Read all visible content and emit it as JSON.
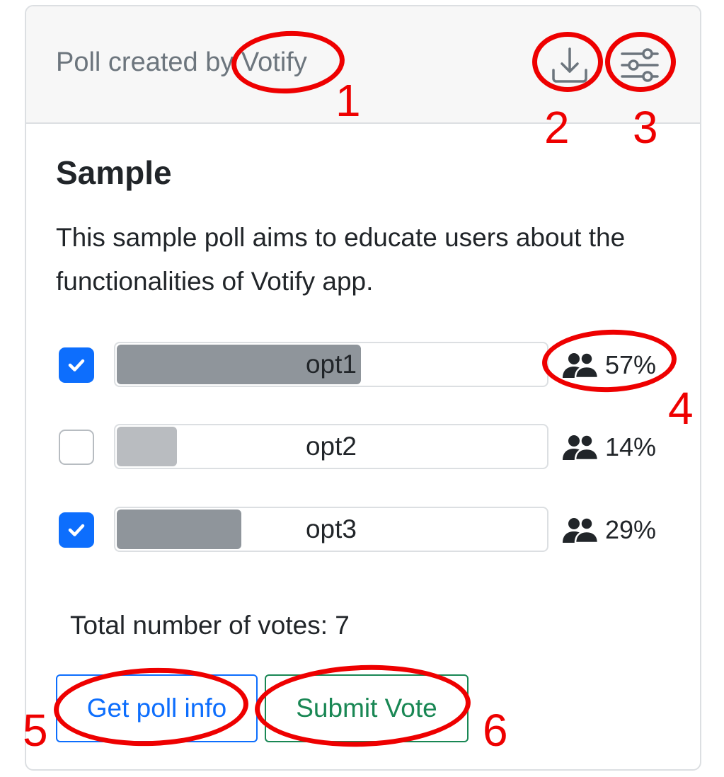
{
  "header": {
    "created_by": "Poll created by Votify",
    "download_icon": "download-icon",
    "settings_icon": "sliders-icon"
  },
  "poll": {
    "title": "Sample",
    "description": "This sample poll aims to educate users about the functionalities of Votify app.",
    "options": [
      {
        "label": "opt1",
        "checked": true,
        "share": 0.57,
        "percent": "57%"
      },
      {
        "label": "opt2",
        "checked": false,
        "share": 0.14,
        "percent": "14%"
      },
      {
        "label": "opt3",
        "checked": true,
        "share": 0.29,
        "percent": "29%"
      }
    ],
    "voters_icon": "people-icon",
    "total_votes": "Total number of votes: 7"
  },
  "buttons": {
    "info_label": "Get poll info",
    "submit_label": "Submit Vote"
  },
  "annotations": {
    "numbers": [
      "1",
      "2",
      "3",
      "4",
      "5",
      "6"
    ],
    "color": "#ee0000"
  },
  "colors": {
    "primary": "#0d6efd",
    "success": "#198754",
    "muted": "#6c757d",
    "bar_dark": "#8f959b",
    "bar_light": "#b9bcc0"
  }
}
